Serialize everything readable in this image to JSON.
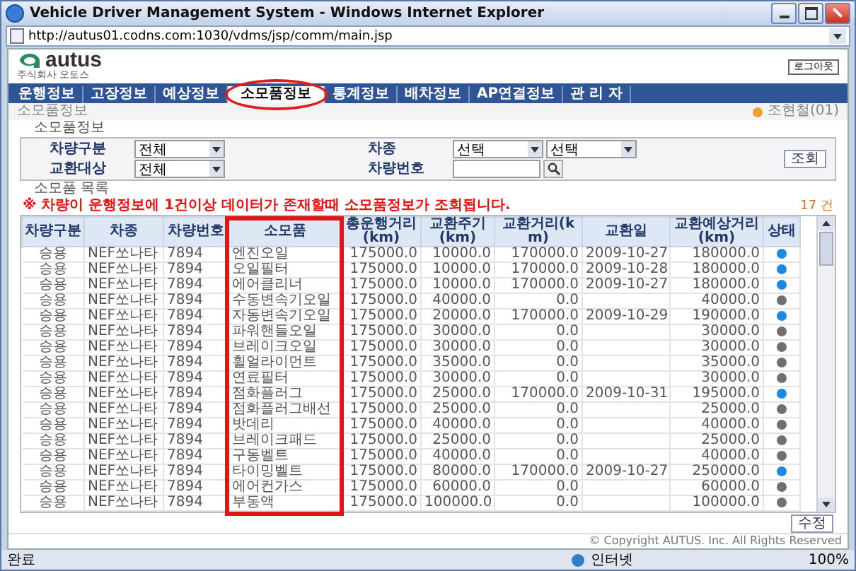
{
  "window": {
    "title": "Vehicle Driver Management System - Windows Internet Explorer",
    "url": "http://autus01.codns.com:1030/vdms/jsp/comm/main.jsp"
  },
  "header": {
    "logo": "autus",
    "company": "주식회사 오토스",
    "logout": "로그아웃"
  },
  "tabs": [
    {
      "label": "운행정보",
      "selected": false,
      "circled": false
    },
    {
      "label": "고장정보",
      "selected": false,
      "circled": false
    },
    {
      "label": "예상정보",
      "selected": false,
      "circled": false
    },
    {
      "label": "소모품정보",
      "selected": true,
      "circled": true
    },
    {
      "label": "통계정보",
      "selected": false,
      "circled": false
    },
    {
      "label": "배차정보",
      "selected": false,
      "circled": false
    },
    {
      "label": "AP연결정보",
      "selected": false,
      "circled": false
    },
    {
      "label": "관 리 자",
      "selected": false,
      "circled": false
    }
  ],
  "breadcrumb": "소모품정보",
  "user": "조현철(01)",
  "filter": {
    "title": "소모품정보",
    "fields": [
      {
        "kind": "select",
        "label": "차량구분",
        "values": [
          "전체"
        ]
      },
      {
        "kind": "select",
        "label": "차종",
        "values": [
          "선택",
          "선택"
        ]
      },
      {
        "kind": "select",
        "label": "교환대상",
        "values": [
          "전체"
        ]
      },
      {
        "kind": "text",
        "label": "차량번호"
      }
    ],
    "search_button": "조회"
  },
  "list": {
    "title": "소모품 목록",
    "note": "※ 차량이 운행정보에 1건이상 데이터가 존재할때 소모품정보가 조회됩니다.",
    "count": "17 건"
  },
  "table": {
    "columns": [
      {
        "label": "차량구분",
        "boxed": false
      },
      {
        "label": "차종",
        "boxed": false
      },
      {
        "label": "차량번호",
        "boxed": false
      },
      {
        "label": "소모품",
        "boxed": true
      },
      {
        "label": "총운행거리(km)",
        "boxed": false
      },
      {
        "label": "교환주기(km)",
        "boxed": false
      },
      {
        "label": "교환거리(km)",
        "boxed": false
      },
      {
        "label": "교환일",
        "boxed": false
      },
      {
        "label": "교환예상거리(km)",
        "boxed": false
      },
      {
        "label": "상태",
        "boxed": false
      }
    ],
    "rows": [
      {
        "cells": [
          "승용",
          "NEF쏘나타",
          "7894",
          "엔진오일",
          "175000.0",
          "10000.0",
          "170000.0",
          "2009-10-27",
          "180000.0"
        ],
        "color": "#1e88e5"
      },
      {
        "cells": [
          "승용",
          "NEF쏘나타",
          "7894",
          "오일필터",
          "175000.0",
          "10000.0",
          "170000.0",
          "2009-10-28",
          "180000.0"
        ],
        "color": "#1e88e5"
      },
      {
        "cells": [
          "승용",
          "NEF쏘나타",
          "7894",
          "에어클리너",
          "175000.0",
          "10000.0",
          "170000.0",
          "2009-10-27",
          "180000.0"
        ],
        "color": "#1e88e5"
      },
      {
        "cells": [
          "승용",
          "NEF쏘나타",
          "7894",
          "수동변속기오일",
          "175000.0",
          "40000.0",
          "0.0",
          "",
          "40000.0"
        ],
        "color": "#707070"
      },
      {
        "cells": [
          "승용",
          "NEF쏘나타",
          "7894",
          "자동변속기오일",
          "175000.0",
          "20000.0",
          "170000.0",
          "2009-10-29",
          "190000.0"
        ],
        "color": "#1e88e5"
      },
      {
        "cells": [
          "승용",
          "NEF쏘나타",
          "7894",
          "파워핸들오일",
          "175000.0",
          "30000.0",
          "0.0",
          "",
          "30000.0"
        ],
        "color": "#707070"
      },
      {
        "cells": [
          "승용",
          "NEF쏘나타",
          "7894",
          "브레이크오일",
          "175000.0",
          "30000.0",
          "0.0",
          "",
          "30000.0"
        ],
        "color": "#707070"
      },
      {
        "cells": [
          "승용",
          "NEF쏘나타",
          "7894",
          "휠얼라이먼트",
          "175000.0",
          "35000.0",
          "0.0",
          "",
          "35000.0"
        ],
        "color": "#707070"
      },
      {
        "cells": [
          "승용",
          "NEF쏘나타",
          "7894",
          "연료필터",
          "175000.0",
          "30000.0",
          "0.0",
          "",
          "30000.0"
        ],
        "color": "#707070"
      },
      {
        "cells": [
          "승용",
          "NEF쏘나타",
          "7894",
          "점화플러그",
          "175000.0",
          "25000.0",
          "170000.0",
          "2009-10-31",
          "195000.0"
        ],
        "color": "#1e88e5"
      },
      {
        "cells": [
          "승용",
          "NEF쏘나타",
          "7894",
          "점화플러그배선",
          "175000.0",
          "25000.0",
          "0.0",
          "",
          "25000.0"
        ],
        "color": "#707070"
      },
      {
        "cells": [
          "승용",
          "NEF쏘나타",
          "7894",
          "밧데리",
          "175000.0",
          "40000.0",
          "0.0",
          "",
          "40000.0"
        ],
        "color": "#707070"
      },
      {
        "cells": [
          "승용",
          "NEF쏘나타",
          "7894",
          "브레이크패드",
          "175000.0",
          "25000.0",
          "0.0",
          "",
          "25000.0"
        ],
        "color": "#707070"
      },
      {
        "cells": [
          "승용",
          "NEF쏘나타",
          "7894",
          "구동벨트",
          "175000.0",
          "40000.0",
          "0.0",
          "",
          "40000.0"
        ],
        "color": "#707070"
      },
      {
        "cells": [
          "승용",
          "NEF쏘나타",
          "7894",
          "타이밍벨트",
          "175000.0",
          "80000.0",
          "170000.0",
          "2009-10-27",
          "250000.0"
        ],
        "color": "#1e88e5"
      },
      {
        "cells": [
          "승용",
          "NEF쏘나타",
          "7894",
          "에어컨가스",
          "175000.0",
          "60000.0",
          "0.0",
          "",
          "60000.0"
        ],
        "color": "#707070"
      },
      {
        "cells": [
          "승용",
          "NEF쏘나타",
          "7894",
          "부동액",
          "175000.0",
          "100000.0",
          "0.0",
          "",
          "100000.0"
        ],
        "color": "#707070"
      }
    ]
  },
  "edit_button": "수정",
  "copyright": "© Copyright AUTUS. Inc. All Rights Reserved",
  "status_bar": {
    "text": "완료",
    "zone": "인터넷",
    "zoom": "100%"
  }
}
